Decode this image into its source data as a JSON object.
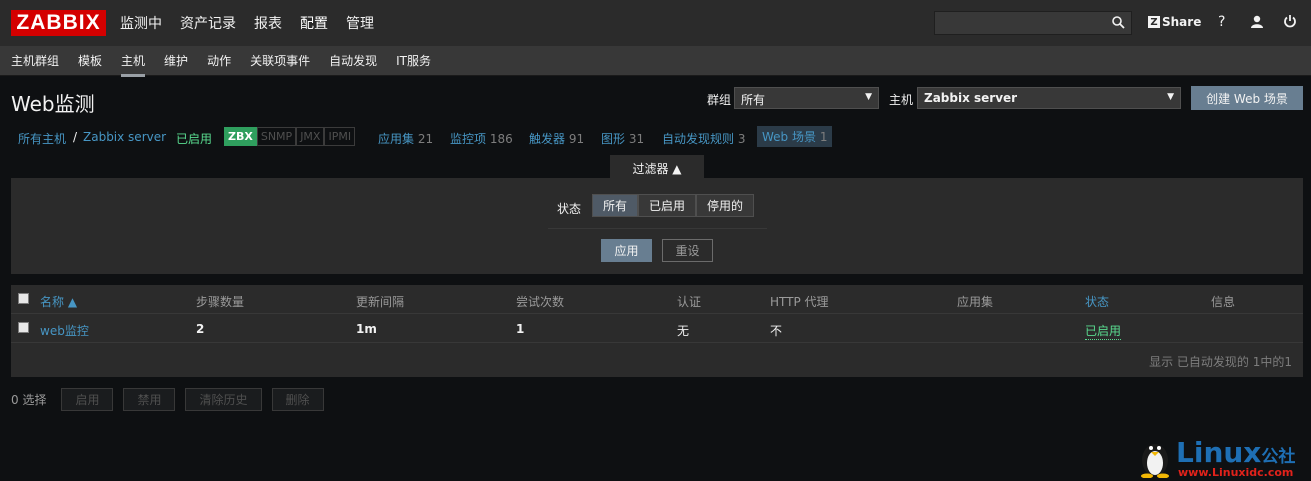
{
  "app": {
    "logo": "ZABBIX"
  },
  "topnav": [
    "监测中",
    "资产记录",
    "报表",
    "配置",
    "管理"
  ],
  "topbar": {
    "share": "Share",
    "help": "?",
    "search_value": ""
  },
  "subnav": [
    "主机群组",
    "模板",
    "主机",
    "维护",
    "动作",
    "关联项事件",
    "自动发现",
    "IT服务"
  ],
  "header": {
    "title": "Web监测",
    "group_label": "群组",
    "group_value": "所有",
    "host_label": "主机",
    "host_value": "Zabbix server",
    "create_button": "创建 Web 场景"
  },
  "breadcrumb": {
    "all_hosts": "所有主机",
    "sep": "/",
    "host": "Zabbix server",
    "enabled": "已启用",
    "tags": [
      "ZBX",
      "SNMP",
      "JMX",
      "IPMI"
    ],
    "apps_label": "应用集",
    "apps_count": "21",
    "items_label": "监控项",
    "items_count": "186",
    "triggers_label": "触发器",
    "triggers_count": "91",
    "graphs_label": "图形",
    "graphs_count": "31",
    "discovery_label": "自动发现规则",
    "discovery_count": "3",
    "web_label": "Web 场景",
    "web_count": "1"
  },
  "filter": {
    "tab_label": "过滤器 ▲",
    "status_label": "状态",
    "status_options": [
      "所有",
      "已启用",
      "停用的"
    ],
    "apply": "应用",
    "reset": "重设"
  },
  "table": {
    "columns": [
      "名称 ▲",
      "步骤数量",
      "更新间隔",
      "尝试次数",
      "认证",
      "HTTP 代理",
      "应用集",
      "状态",
      "信息"
    ],
    "rows": [
      {
        "name": "web监控",
        "steps": "2",
        "interval": "1m",
        "attempts": "1",
        "auth": "无",
        "proxy": "不",
        "apps": "",
        "status": "已启用",
        "info": ""
      }
    ],
    "footer": "显示 已自动发现的 1中的1"
  },
  "actions": {
    "selected": "0 选择",
    "buttons": [
      "启用",
      "禁用",
      "清除历史",
      "删除"
    ]
  },
  "watermark": {
    "title": "Linux",
    "title_cn": "公社",
    "url": "www.Linuxidc.com"
  },
  "colors": {
    "accent": "#4796c4",
    "enabled": "#59db8f",
    "logo_red": "#d40000",
    "button": "#687e91"
  }
}
